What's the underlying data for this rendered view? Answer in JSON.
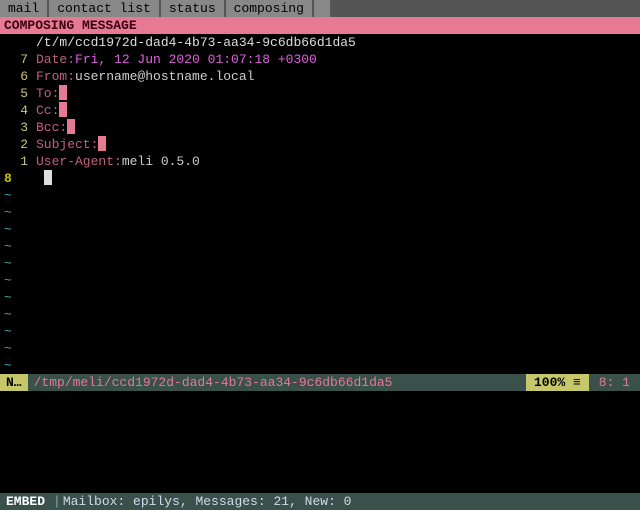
{
  "tabs": {
    "t0": "mail",
    "t1": "contact list",
    "t2": "status",
    "t3": "composing"
  },
  "titlebar": "COMPOSING MESSAGE",
  "file_header": "/t/m/ccd1972d-dad4-4b73-aa34-9c6db66d1da5",
  "gutters": {
    "g7": "7",
    "g6": "6",
    "g5": "5",
    "g4": "4",
    "g3": "3",
    "g2": "2",
    "g1": "1",
    "g8": "8"
  },
  "headers": {
    "date_k": "Date: ",
    "date_v": "Fri, 12 Jun 2020 01:07:18 +0300",
    "from_k": "From: ",
    "from_v": "username@hostname.local",
    "to_k": "To:",
    "cc_k": "Cc:",
    "bcc_k": "Bcc:",
    "subj_k": "Subject:",
    "ua_k": "User-Agent: ",
    "ua_v": "meli 0.5.0"
  },
  "tilde": "~",
  "status": {
    "mode": "N…",
    "path": "/tmp/meli/ccd1972d-dad4-4b73-aa34-9c6db66d1da5",
    "pct": "100% ≡",
    "pos": "   8:   1"
  },
  "bottom": {
    "mode": "EMBED",
    "sep": "|",
    "text": " Mailbox: epilys, Messages: 21, New: 0"
  }
}
